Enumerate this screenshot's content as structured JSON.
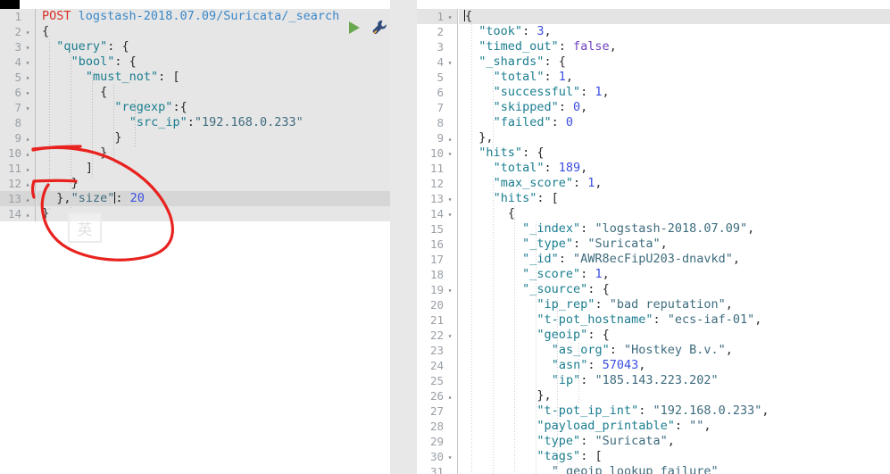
{
  "app": {
    "name": "elasticsearch-query-console",
    "accent_red": "#e8221e",
    "play_color": "#6aa84f",
    "editor_bg_left": "#e6e6e6",
    "editor_bg_right": "#ffffff",
    "current_line_bg": "#d6d6d6"
  },
  "toolbar": {
    "run_label": "play-button",
    "settings_label": "wrench-button"
  },
  "request_editor": {
    "title": "request-editor",
    "method": "POST",
    "endpoint": "logstash-2018.07.09/Suricata/_search",
    "current_line": 13,
    "lines": [
      {
        "n": 1,
        "fold": "",
        "text": ""
      },
      {
        "n": 2,
        "fold": "▾",
        "text": "{"
      },
      {
        "n": 3,
        "fold": "▾",
        "text": "  \"query\": {"
      },
      {
        "n": 4,
        "fold": "▾",
        "text": "    \"bool\": {"
      },
      {
        "n": 5,
        "fold": "▾",
        "text": "      \"must_not\": ["
      },
      {
        "n": 6,
        "fold": "▾",
        "text": "        {"
      },
      {
        "n": 7,
        "fold": "▾",
        "text": "          \"regexp\":{"
      },
      {
        "n": 8,
        "fold": "",
        "text": "            \"src_ip\":\"192.168.0.233\""
      },
      {
        "n": 9,
        "fold": "▴",
        "text": "          }"
      },
      {
        "n": 10,
        "fold": "▴",
        "text": "        }"
      },
      {
        "n": 11,
        "fold": "▴",
        "text": "      ]"
      },
      {
        "n": 12,
        "fold": "▴",
        "text": "    }"
      },
      {
        "n": 13,
        "fold": "▴",
        "text": "  },\"size\": 20"
      },
      {
        "n": 14,
        "fold": "▴",
        "text": "}"
      }
    ]
  },
  "response_editor": {
    "title": "response-viewer",
    "current_line": 1,
    "lines": [
      {
        "n": 1,
        "fold": "▾",
        "text": "{"
      },
      {
        "n": 2,
        "fold": "",
        "text": "  \"took\": 3,"
      },
      {
        "n": 3,
        "fold": "",
        "text": "  \"timed_out\": false,"
      },
      {
        "n": 4,
        "fold": "▾",
        "text": "  \"_shards\": {"
      },
      {
        "n": 5,
        "fold": "",
        "text": "    \"total\": 1,"
      },
      {
        "n": 6,
        "fold": "",
        "text": "    \"successful\": 1,"
      },
      {
        "n": 7,
        "fold": "",
        "text": "    \"skipped\": 0,"
      },
      {
        "n": 8,
        "fold": "",
        "text": "    \"failed\": 0"
      },
      {
        "n": 9,
        "fold": "▴",
        "text": "  },"
      },
      {
        "n": 10,
        "fold": "▾",
        "text": "  \"hits\": {"
      },
      {
        "n": 11,
        "fold": "",
        "text": "    \"total\": 189,"
      },
      {
        "n": 12,
        "fold": "",
        "text": "    \"max_score\": 1,"
      },
      {
        "n": 13,
        "fold": "▾",
        "text": "    \"hits\": ["
      },
      {
        "n": 14,
        "fold": "▾",
        "text": "      {"
      },
      {
        "n": 15,
        "fold": "",
        "text": "        \"_index\": \"logstash-2018.07.09\","
      },
      {
        "n": 16,
        "fold": "",
        "text": "        \"_type\": \"Suricata\","
      },
      {
        "n": 17,
        "fold": "",
        "text": "        \"_id\": \"AWR8ecFipU203-dnavkd\","
      },
      {
        "n": 18,
        "fold": "",
        "text": "        \"_score\": 1,"
      },
      {
        "n": 19,
        "fold": "▾",
        "text": "        \"_source\": {"
      },
      {
        "n": 20,
        "fold": "",
        "text": "          \"ip_rep\": \"bad reputation\","
      },
      {
        "n": 21,
        "fold": "",
        "text": "          \"t-pot_hostname\": \"ecs-iaf-01\","
      },
      {
        "n": 22,
        "fold": "▾",
        "text": "          \"geoip\": {"
      },
      {
        "n": 23,
        "fold": "",
        "text": "            \"as_org\": \"Hostkey B.v.\","
      },
      {
        "n": 24,
        "fold": "",
        "text": "            \"asn\": 57043,"
      },
      {
        "n": 25,
        "fold": "",
        "text": "            \"ip\": \"185.143.223.202\""
      },
      {
        "n": 26,
        "fold": "▴",
        "text": "          },"
      },
      {
        "n": 27,
        "fold": "",
        "text": "          \"t-pot_ip_int\": \"192.168.0.233\","
      },
      {
        "n": 28,
        "fold": "",
        "text": "          \"payload_printable\": \"\","
      },
      {
        "n": 29,
        "fold": "",
        "text": "          \"type\": \"Suricata\","
      },
      {
        "n": 30,
        "fold": "▾",
        "text": "          \"tags\": ["
      },
      {
        "n": 31,
        "fold": "",
        "text": "            \"_geoip_lookup_failure\""
      }
    ]
  },
  "ime_indicator": {
    "label": "英"
  },
  "annotation": {
    "color": "#e8221e",
    "shape": "hand-drawn-ellipse-highlighting-size-parameter"
  }
}
